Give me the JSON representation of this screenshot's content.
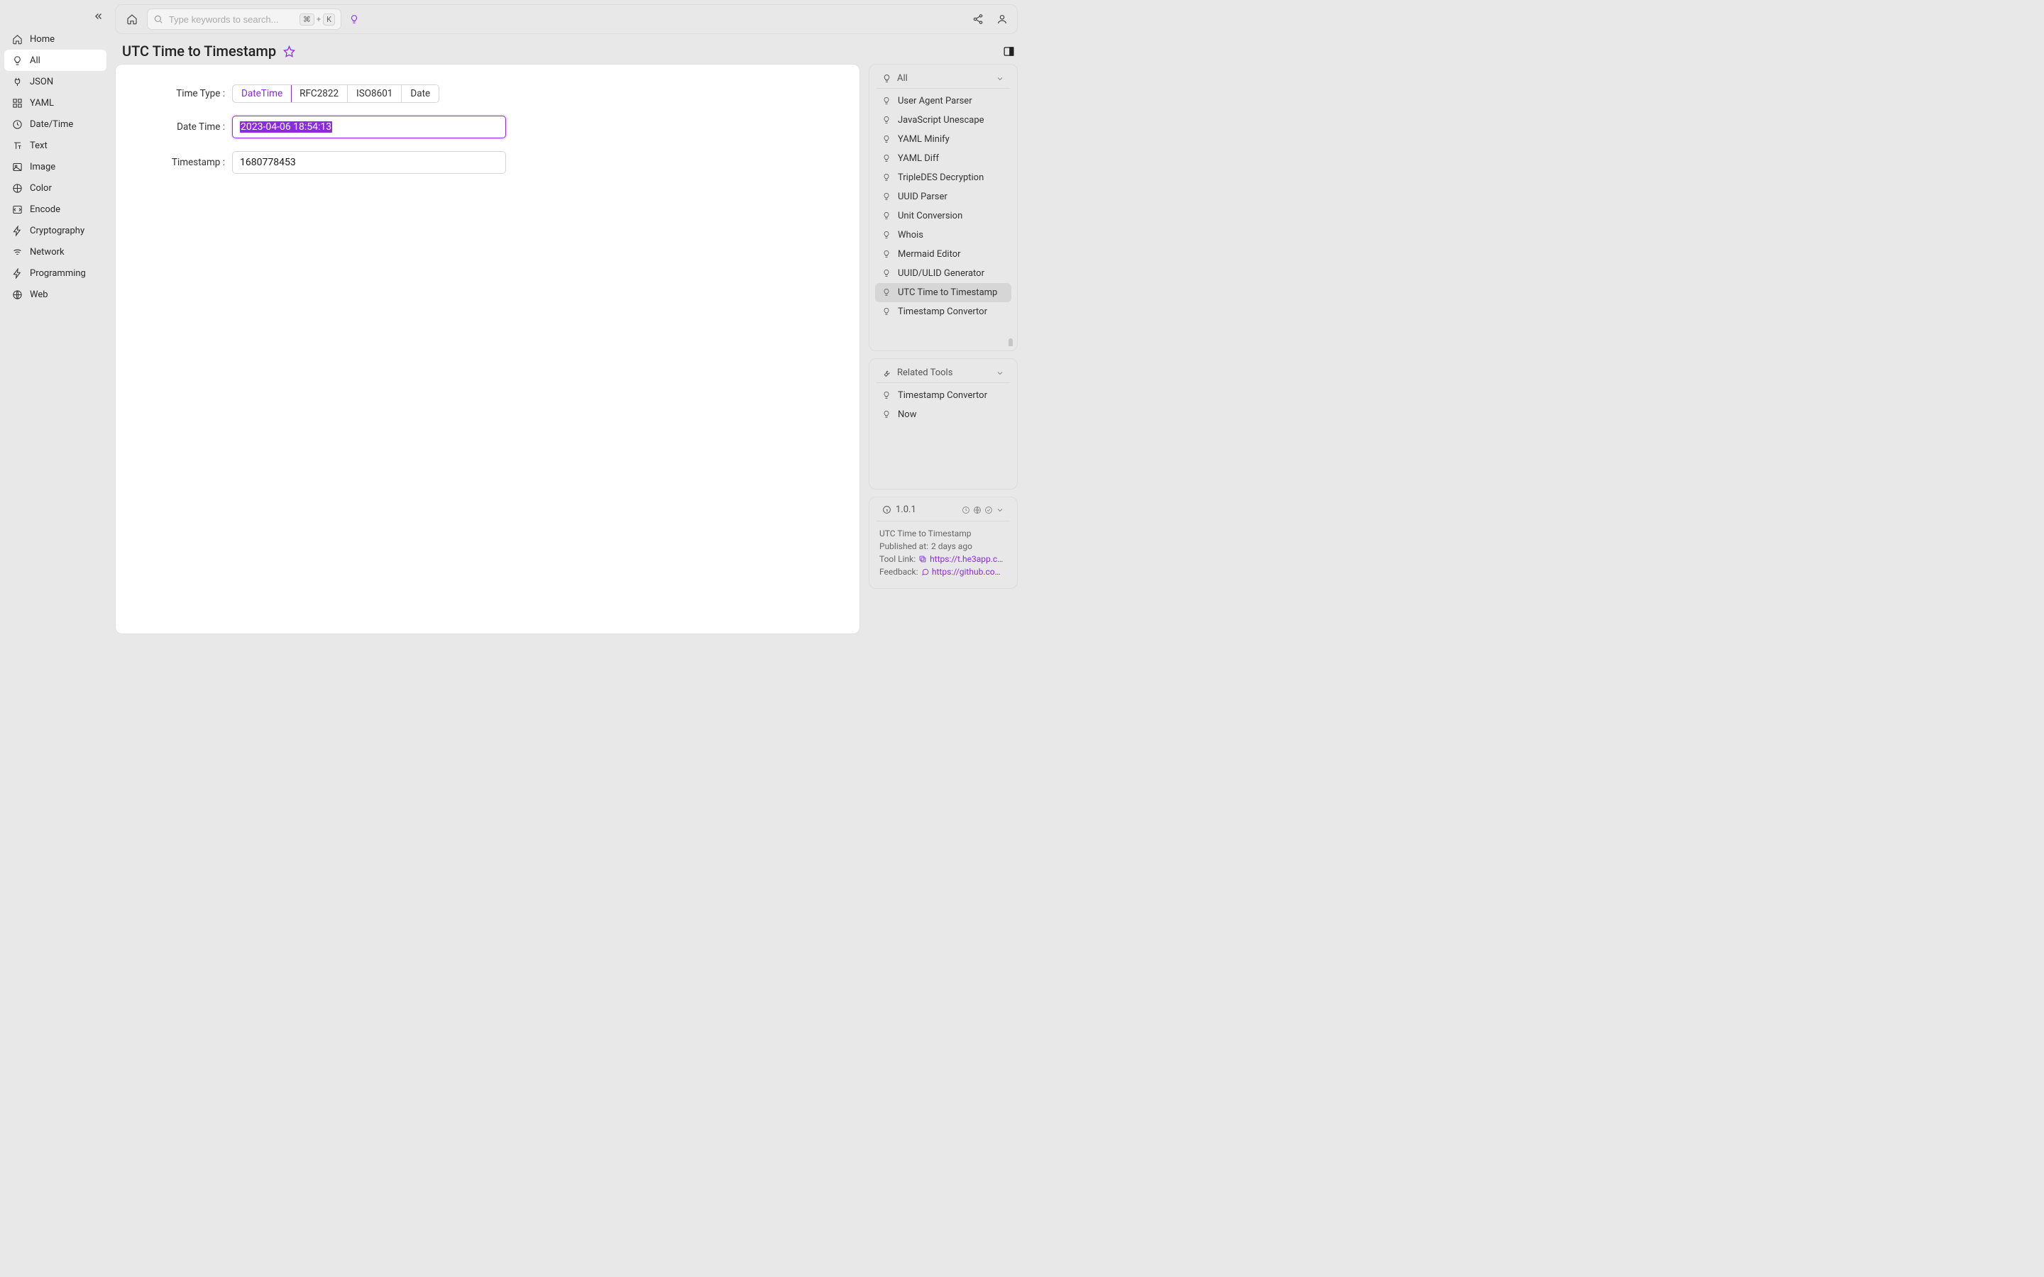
{
  "sidebar": {
    "items": [
      {
        "icon": "home",
        "label": "Home"
      },
      {
        "icon": "bulb",
        "label": "All"
      },
      {
        "icon": "plug",
        "label": "JSON"
      },
      {
        "icon": "grid",
        "label": "YAML"
      },
      {
        "icon": "clock",
        "label": "Date/Time"
      },
      {
        "icon": "text",
        "label": "Text"
      },
      {
        "icon": "image",
        "label": "Image"
      },
      {
        "icon": "color",
        "label": "Color"
      },
      {
        "icon": "encode",
        "label": "Encode"
      },
      {
        "icon": "bolt",
        "label": "Cryptography"
      },
      {
        "icon": "wifi",
        "label": "Network"
      },
      {
        "icon": "bolt",
        "label": "Programming"
      },
      {
        "icon": "globe",
        "label": "Web"
      }
    ],
    "active_index": 1
  },
  "search": {
    "placeholder": "Type keywords to search...",
    "shortcut": {
      "mod": "⌘",
      "plus": "+",
      "key": "K"
    }
  },
  "page": {
    "title": "UTC Time to Timestamp"
  },
  "form": {
    "time_type_label": "Time Type",
    "date_time_label": "Date Time",
    "timestamp_label": "Timestamp",
    "time_types": [
      "DateTime",
      "RFC2822",
      "ISO8601",
      "Date"
    ],
    "time_type_active": 0,
    "date_time_value": "2023-04-06 18:54:13",
    "timestamp_value": "1680778453"
  },
  "right": {
    "all_header": "All",
    "all_items": [
      "User Agent Parser",
      "JavaScript Unescape",
      "YAML Minify",
      "YAML Diff",
      "TripleDES Decryption",
      "UUID Parser",
      "Unit Conversion",
      "Whois",
      "Mermaid Editor",
      "UUID/ULID Generator",
      "UTC Time to Timestamp",
      "Timestamp Convertor"
    ],
    "all_active_index": 10,
    "related_header": "Related Tools",
    "related_items": [
      "Timestamp Convertor",
      "Now"
    ]
  },
  "info": {
    "version": "1.0.1",
    "tool_name": "UTC Time to Timestamp",
    "published_label": "Published at:",
    "published_value": "2 days ago",
    "tool_link_label": "Tool Link:",
    "tool_link_value": "https://t.he3app.co…",
    "feedback_label": "Feedback:",
    "feedback_value": "https://github.com/…"
  }
}
